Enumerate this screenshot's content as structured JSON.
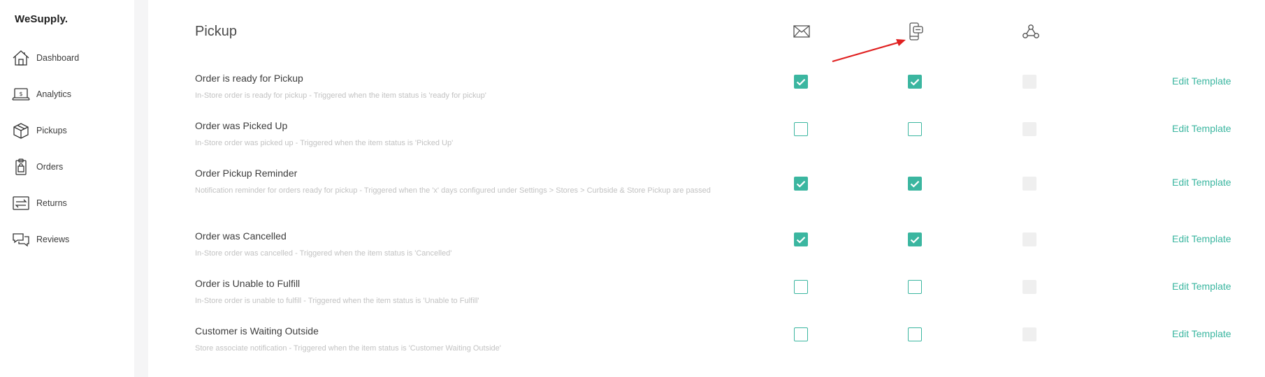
{
  "brand": "WeSupply.",
  "sidebar": {
    "items": [
      {
        "label": "Dashboard",
        "icon": "home-icon"
      },
      {
        "label": "Analytics",
        "icon": "laptop-dollar-icon"
      },
      {
        "label": "Pickups",
        "icon": "box-icon"
      },
      {
        "label": "Orders",
        "icon": "clipboard-bag-icon"
      },
      {
        "label": "Returns",
        "icon": "returns-arrows-icon"
      },
      {
        "label": "Reviews",
        "icon": "chat-bubbles-icon"
      }
    ]
  },
  "section": {
    "title": "Pickup",
    "columns": [
      {
        "channel": "email",
        "icon": "envelope-icon"
      },
      {
        "channel": "sms",
        "icon": "mobile-message-icon"
      },
      {
        "channel": "webhook",
        "icon": "webhook-icon"
      }
    ]
  },
  "rows": [
    {
      "title": "Order is ready for Pickup",
      "description": "In-Store order is ready for pickup - Triggered when the item status is 'ready for pickup'",
      "email": true,
      "sms": true,
      "webhook_disabled": true,
      "action": "Edit Template"
    },
    {
      "title": "Order was Picked Up",
      "description": "In-Store order was picked up - Triggered when the item status is 'Picked Up'",
      "email": false,
      "sms": false,
      "webhook_disabled": true,
      "action": "Edit Template"
    },
    {
      "title": "Order Pickup Reminder",
      "description": "Notification reminder for orders ready for pickup - Triggered when the 'x' days configured under Settings > Stores > Curbside & Store Pickup are passed",
      "email": true,
      "sms": true,
      "webhook_disabled": true,
      "action": "Edit Template"
    },
    {
      "title": "Order was Cancelled",
      "description": "In-Store order was cancelled - Triggered when the item status is 'Cancelled'",
      "email": true,
      "sms": true,
      "webhook_disabled": true,
      "action": "Edit Template"
    },
    {
      "title": "Order is Unable to Fulfill",
      "description": "In-Store order is unable to fulfill - Triggered when the item status is 'Unable to Fulfill'",
      "email": false,
      "sms": false,
      "webhook_disabled": true,
      "action": "Edit Template"
    },
    {
      "title": "Customer is Waiting Outside",
      "description": "Store associate notification - Triggered when the item status is 'Customer Waiting Outside'",
      "email": false,
      "sms": false,
      "webhook_disabled": true,
      "action": "Edit Template"
    }
  ],
  "colors": {
    "accent": "#3bb6a0",
    "annotation": "#e02020"
  }
}
